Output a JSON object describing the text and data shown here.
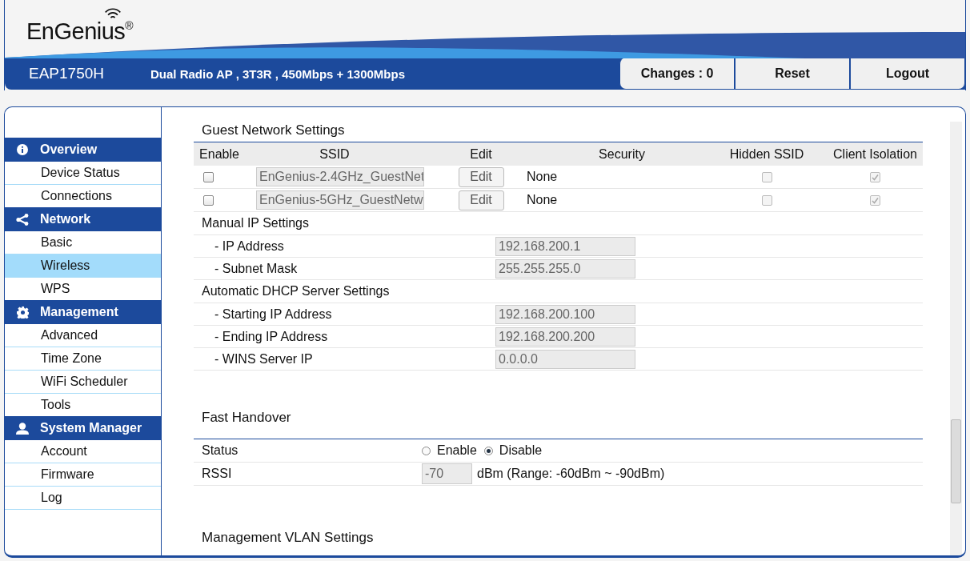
{
  "header": {
    "logo": "EnGenius",
    "logo_mark": "®",
    "model": "EAP1750H",
    "description": "Dual Radio AP , 3T3R , 450Mbps + 1300Mbps",
    "buttons": [
      "Changes : 0",
      "Reset",
      "Logout"
    ]
  },
  "sidebar": {
    "groups": [
      {
        "title": "Overview",
        "kind": "info",
        "items": [
          {
            "label": "Device Status",
            "selected": false
          },
          {
            "label": "Connections",
            "selected": false
          }
        ]
      },
      {
        "title": "Network",
        "kind": "share",
        "items": [
          {
            "label": "Basic",
            "selected": false
          },
          {
            "label": "Wireless",
            "selected": true
          },
          {
            "label": "WPS",
            "selected": false
          }
        ]
      },
      {
        "title": "Management",
        "kind": "gear",
        "items": [
          {
            "label": "Advanced",
            "selected": false
          },
          {
            "label": "Time Zone",
            "selected": false
          },
          {
            "label": "WiFi Scheduler",
            "selected": false
          },
          {
            "label": "Tools",
            "selected": false
          }
        ]
      },
      {
        "title": "System Manager",
        "kind": "person",
        "items": [
          {
            "label": "Account",
            "selected": false
          },
          {
            "label": "Firmware",
            "selected": false
          },
          {
            "label": "Log",
            "selected": false
          }
        ]
      }
    ]
  },
  "guest_network": {
    "title": "Guest Network Settings",
    "columns": [
      "Enable",
      "SSID",
      "Edit",
      "Security",
      "Hidden SSID",
      "Client Isolation"
    ],
    "rows": [
      {
        "enabled": false,
        "ssid": "EnGenius-2.4GHz_GuestNet",
        "edit": "Edit",
        "security": "None",
        "hidden_ssid": false,
        "hidden_ssid_disabled": true,
        "client_isolation": true,
        "client_isolation_disabled": true
      },
      {
        "enabled": false,
        "ssid": "EnGenius-5GHz_GuestNetw",
        "edit": "Edit",
        "security": "None",
        "hidden_ssid": false,
        "hidden_ssid_disabled": true,
        "client_isolation": true,
        "client_isolation_disabled": true
      }
    ],
    "groups": [
      {
        "title": "Manual IP Settings",
        "fields": [
          {
            "label": "- IP Address",
            "value": "192.168.200.1"
          },
          {
            "label": "- Subnet Mask",
            "value": "255.255.255.0"
          }
        ]
      },
      {
        "title": "Automatic DHCP Server Settings",
        "fields": [
          {
            "label": "- Starting IP Address",
            "value": "192.168.200.100"
          },
          {
            "label": "- Ending IP Address",
            "value": "192.168.200.200"
          },
          {
            "label": "- WINS Server IP",
            "value": "0.0.0.0"
          }
        ]
      }
    ]
  },
  "fast_handover": {
    "title": "Fast Handover",
    "status_label": "Status",
    "status_options": [
      {
        "label": "Enable",
        "selected": false
      },
      {
        "label": "Disable",
        "selected": true
      }
    ],
    "rssi_label": "RSSI",
    "rssi_value": "-70",
    "rssi_hint": "dBm (Range: -60dBm ~ -90dBm)"
  },
  "management_vlan": {
    "title": "Management VLAN Settings"
  }
}
